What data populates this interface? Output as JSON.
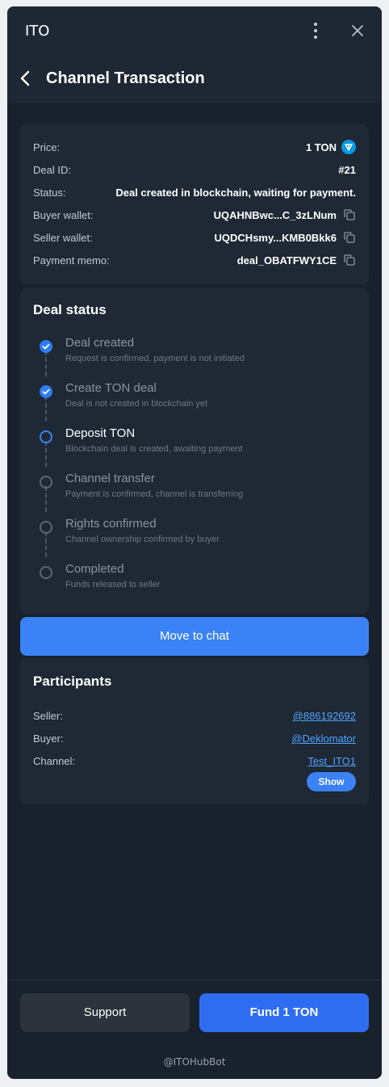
{
  "window": {
    "app_title": "ITO"
  },
  "header": {
    "title": "Channel Transaction"
  },
  "deal_info": {
    "price": {
      "label": "Price:",
      "value": "1 TON"
    },
    "deal_id": {
      "label": "Deal ID:",
      "value": "#21"
    },
    "status": {
      "label": "Status:",
      "value": "Deal created in blockchain, waiting for payment."
    },
    "buyer_wallet": {
      "label": "Buyer wallet:",
      "value": "UQAHNBwc...C_3zLNum"
    },
    "seller_wallet": {
      "label": "Seller wallet:",
      "value": "UQDCHsmy...KMB0Bkk6"
    },
    "payment_memo": {
      "label": "Payment memo:",
      "value": "deal_OBATFWY1CE"
    }
  },
  "deal_status": {
    "title": "Deal status",
    "steps": [
      {
        "title": "Deal created",
        "desc": "Request is confirmed, payment is not initiated",
        "state": "done"
      },
      {
        "title": "Create TON deal",
        "desc": "Deal is not created in blockchain yet",
        "state": "done"
      },
      {
        "title": "Deposit TON",
        "desc": "Blockchain deal is created, awaiting payment",
        "state": "current"
      },
      {
        "title": "Channel transfer",
        "desc": "Payment is confirmed, channel is transferring",
        "state": "pending"
      },
      {
        "title": "Rights confirmed",
        "desc": "Channel ownership confirmed by buyer",
        "state": "pending"
      },
      {
        "title": "Completed",
        "desc": "Funds released to seller",
        "state": "pending"
      }
    ]
  },
  "move_to_chat_label": "Move to chat",
  "participants": {
    "title": "Participants",
    "seller": {
      "label": "Seller:",
      "value": "@886192692"
    },
    "buyer": {
      "label": "Buyer:",
      "value": "@Deklomator"
    },
    "channel": {
      "label": "Channel:",
      "value": "Test_ITO1"
    },
    "show_label": "Show"
  },
  "footer": {
    "support_label": "Support",
    "fund_label": "Fund 1 TON",
    "bot_name": "@ITOHubBot"
  },
  "icons": {
    "menu": "vertical-dots-icon",
    "close": "close-icon",
    "back": "chevron-left-icon",
    "copy": "copy-icon",
    "ton": "ton-logo-icon",
    "check": "check-icon"
  },
  "colors": {
    "accent": "#3b82f6",
    "fund_button": "#2f6df0",
    "link": "#4ea3ff",
    "ton_badge": "#0a98e8"
  }
}
